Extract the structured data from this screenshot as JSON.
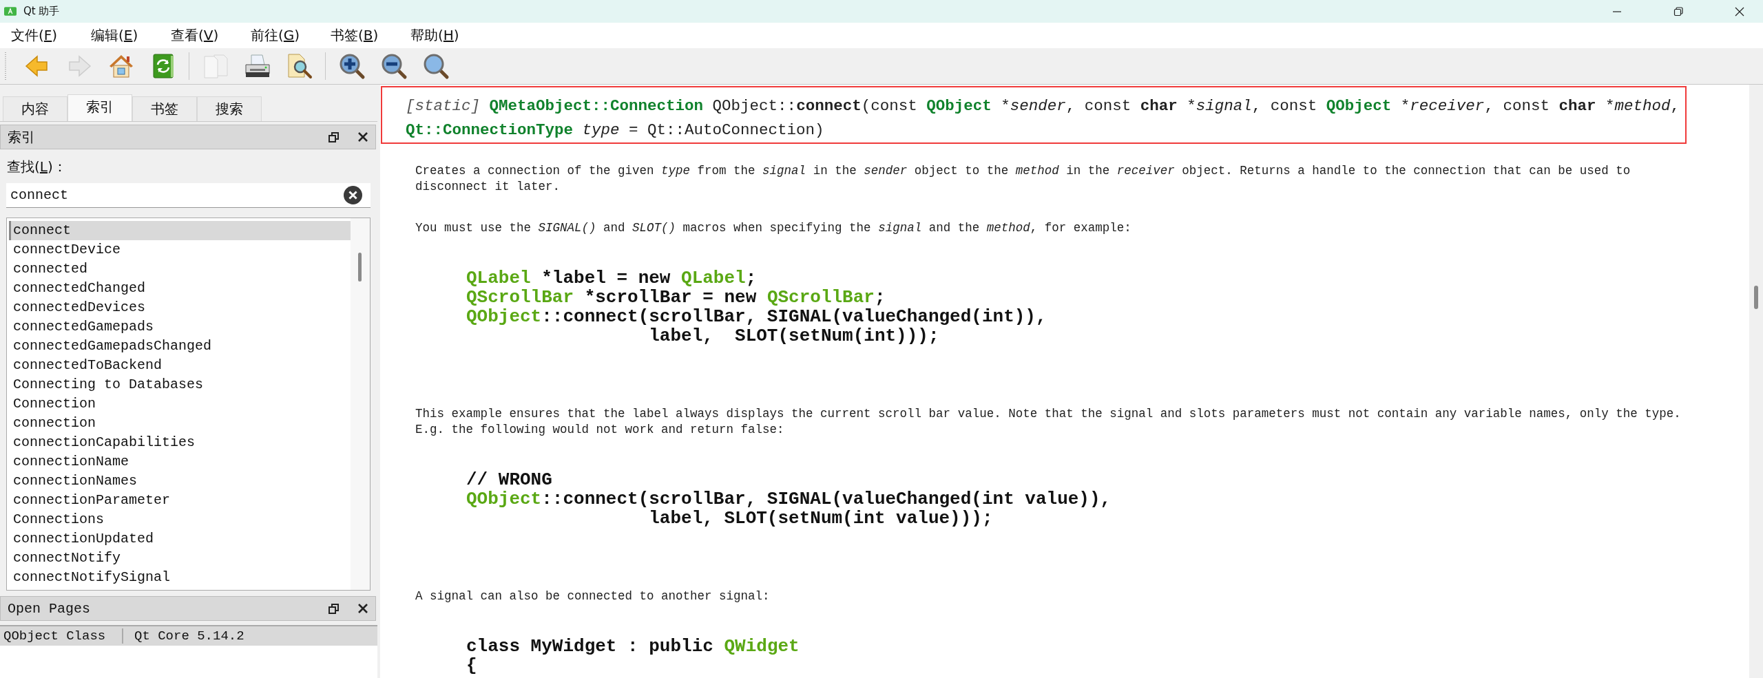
{
  "window": {
    "title": "Qt 助手"
  },
  "menu": [
    {
      "prefix": "文件(",
      "key": "F",
      "suffix": ")"
    },
    {
      "prefix": "编辑(",
      "key": "E",
      "suffix": ")"
    },
    {
      "prefix": "查看(",
      "key": "V",
      "suffix": ")"
    },
    {
      "prefix": "前往(",
      "key": "G",
      "suffix": ")"
    },
    {
      "prefix": "书签(",
      "key": "B",
      "suffix": ")"
    },
    {
      "prefix": "帮助(",
      "key": "H",
      "suffix": ")"
    }
  ],
  "toolbar_groups": [
    [
      {
        "kind": "back",
        "disabled": false
      },
      {
        "kind": "forward",
        "disabled": true
      },
      {
        "kind": "home",
        "disabled": false
      },
      {
        "kind": "sync",
        "disabled": false
      }
    ],
    [
      {
        "kind": "copy",
        "disabled": true
      },
      {
        "kind": "print",
        "disabled": false
      },
      {
        "kind": "find",
        "disabled": false
      }
    ],
    [
      {
        "kind": "zoom-in",
        "disabled": false
      },
      {
        "kind": "zoom-out",
        "disabled": false
      },
      {
        "kind": "zoom-reset",
        "disabled": false
      }
    ]
  ],
  "tabs": [
    {
      "label": "内容",
      "selected": false
    },
    {
      "label": "索引",
      "selected": true
    },
    {
      "label": "书签",
      "selected": false
    },
    {
      "label": "搜索",
      "selected": false
    }
  ],
  "index_panel": {
    "title": "索引",
    "search_label": {
      "prefix": "查找(",
      "key": "L",
      "suffix": ")："
    },
    "search_value": "connect",
    "items": [
      {
        "label": "connect",
        "selected": true
      },
      {
        "label": "connectDevice",
        "selected": false
      },
      {
        "label": "connected",
        "selected": false
      },
      {
        "label": "connectedChanged",
        "selected": false
      },
      {
        "label": "connectedDevices",
        "selected": false
      },
      {
        "label": "connectedGamepads",
        "selected": false
      },
      {
        "label": "connectedGamepadsChanged",
        "selected": false
      },
      {
        "label": "connectedToBackend",
        "selected": false
      },
      {
        "label": "Connecting to Databases",
        "selected": false
      },
      {
        "label": "Connection",
        "selected": false
      },
      {
        "label": "connection",
        "selected": false
      },
      {
        "label": "connectionCapabilities",
        "selected": false
      },
      {
        "label": "connectionName",
        "selected": false
      },
      {
        "label": "connectionNames",
        "selected": false
      },
      {
        "label": "connectionParameter",
        "selected": false
      },
      {
        "label": "Connections",
        "selected": false
      },
      {
        "label": "connectionUpdated",
        "selected": false
      },
      {
        "label": "connectNotify",
        "selected": false
      },
      {
        "label": "connectNotifySignal",
        "selected": false
      }
    ]
  },
  "open_pages": {
    "title": "Open Pages",
    "pages": [
      {
        "title": "QObject Class",
        "module": "Qt Core 5.14.2",
        "selected": true
      }
    ]
  },
  "document": {
    "signature": [
      [
        {
          "text": "[static] ",
          "kind": "muted"
        },
        {
          "text": "QMetaObject::Connection",
          "kind": "type"
        },
        {
          "text": " QObject::",
          "kind": "plain"
        },
        {
          "text": "connect",
          "kind": "bold"
        },
        {
          "text": "(const ",
          "kind": "plain"
        },
        {
          "text": "QObject",
          "kind": "type"
        },
        {
          "text": " *",
          "kind": "plain"
        },
        {
          "text": "sender",
          "kind": "italic"
        },
        {
          "text": ", const ",
          "kind": "plain"
        },
        {
          "text": "char",
          "kind": "bold"
        },
        {
          "text": " *",
          "kind": "plain"
        },
        {
          "text": "signal",
          "kind": "italic"
        },
        {
          "text": ", const ",
          "kind": "plain"
        },
        {
          "text": "QObject",
          "kind": "type"
        },
        {
          "text": " *",
          "kind": "plain"
        },
        {
          "text": "receiver",
          "kind": "italic"
        },
        {
          "text": ", const ",
          "kind": "plain"
        },
        {
          "text": "char",
          "kind": "bold"
        },
        {
          "text": " *",
          "kind": "plain"
        },
        {
          "text": "method",
          "kind": "italic"
        },
        {
          "text": ",",
          "kind": "plain"
        }
      ],
      [
        {
          "text": "Qt::ConnectionType ",
          "kind": "type"
        },
        {
          "text": "type",
          "kind": "italic"
        },
        {
          "text": " = Qt::AutoConnection)",
          "kind": "plain"
        }
      ]
    ],
    "blocks": [
      {
        "kind": "paragraph",
        "text": "Creates a connection of the given *type* from the *signal* in the *sender* object to the *method* in the *receiver* object. Returns a handle to the connection that can be used to disconnect it later."
      },
      {
        "kind": "paragraph",
        "text": "You must use the *SIGNAL()* and *SLOT()* macros when specifying the *signal* and the *method*, for example:"
      },
      {
        "kind": "code",
        "lines": [
          [
            {
              "text": "QLabel",
              "kind": "type"
            },
            {
              "text": " *label = new ",
              "kind": "plain"
            },
            {
              "text": "QLabel",
              "kind": "type"
            },
            {
              "text": ";",
              "kind": "plain"
            }
          ],
          [
            {
              "text": "QScrollBar",
              "kind": "type"
            },
            {
              "text": " *scrollBar = new ",
              "kind": "plain"
            },
            {
              "text": "QScrollBar",
              "kind": "type"
            },
            {
              "text": ";",
              "kind": "plain"
            }
          ],
          [
            {
              "text": "QObject",
              "kind": "type"
            },
            {
              "text": "::connect(scrollBar, SIGNAL(valueChanged(int)),",
              "kind": "plain"
            }
          ],
          [
            {
              "text": "                 label,  SLOT(setNum(int)));",
              "kind": "plain"
            }
          ]
        ]
      },
      {
        "kind": "paragraph",
        "text": "This example ensures that the label always displays the current scroll bar value. Note that the signal and slots parameters must not contain any variable names, only the type. E.g. the following would not work and return false:"
      },
      {
        "kind": "code",
        "lines": [
          [
            {
              "text": "// WRONG",
              "kind": "plain"
            }
          ],
          [
            {
              "text": "QObject",
              "kind": "type"
            },
            {
              "text": "::connect(scrollBar, SIGNAL(valueChanged(int value)),",
              "kind": "plain"
            }
          ],
          [
            {
              "text": "                 label, SLOT(setNum(int value)));",
              "kind": "plain"
            }
          ]
        ]
      },
      {
        "kind": "paragraph",
        "text": "A signal can also be connected to another signal:"
      },
      {
        "kind": "code",
        "lines": [
          [
            {
              "text": "class MyWidget : public ",
              "kind": "plain"
            },
            {
              "text": "QWidget",
              "kind": "type"
            }
          ],
          [
            {
              "text": "{",
              "kind": "plain"
            }
          ]
        ]
      }
    ]
  }
}
